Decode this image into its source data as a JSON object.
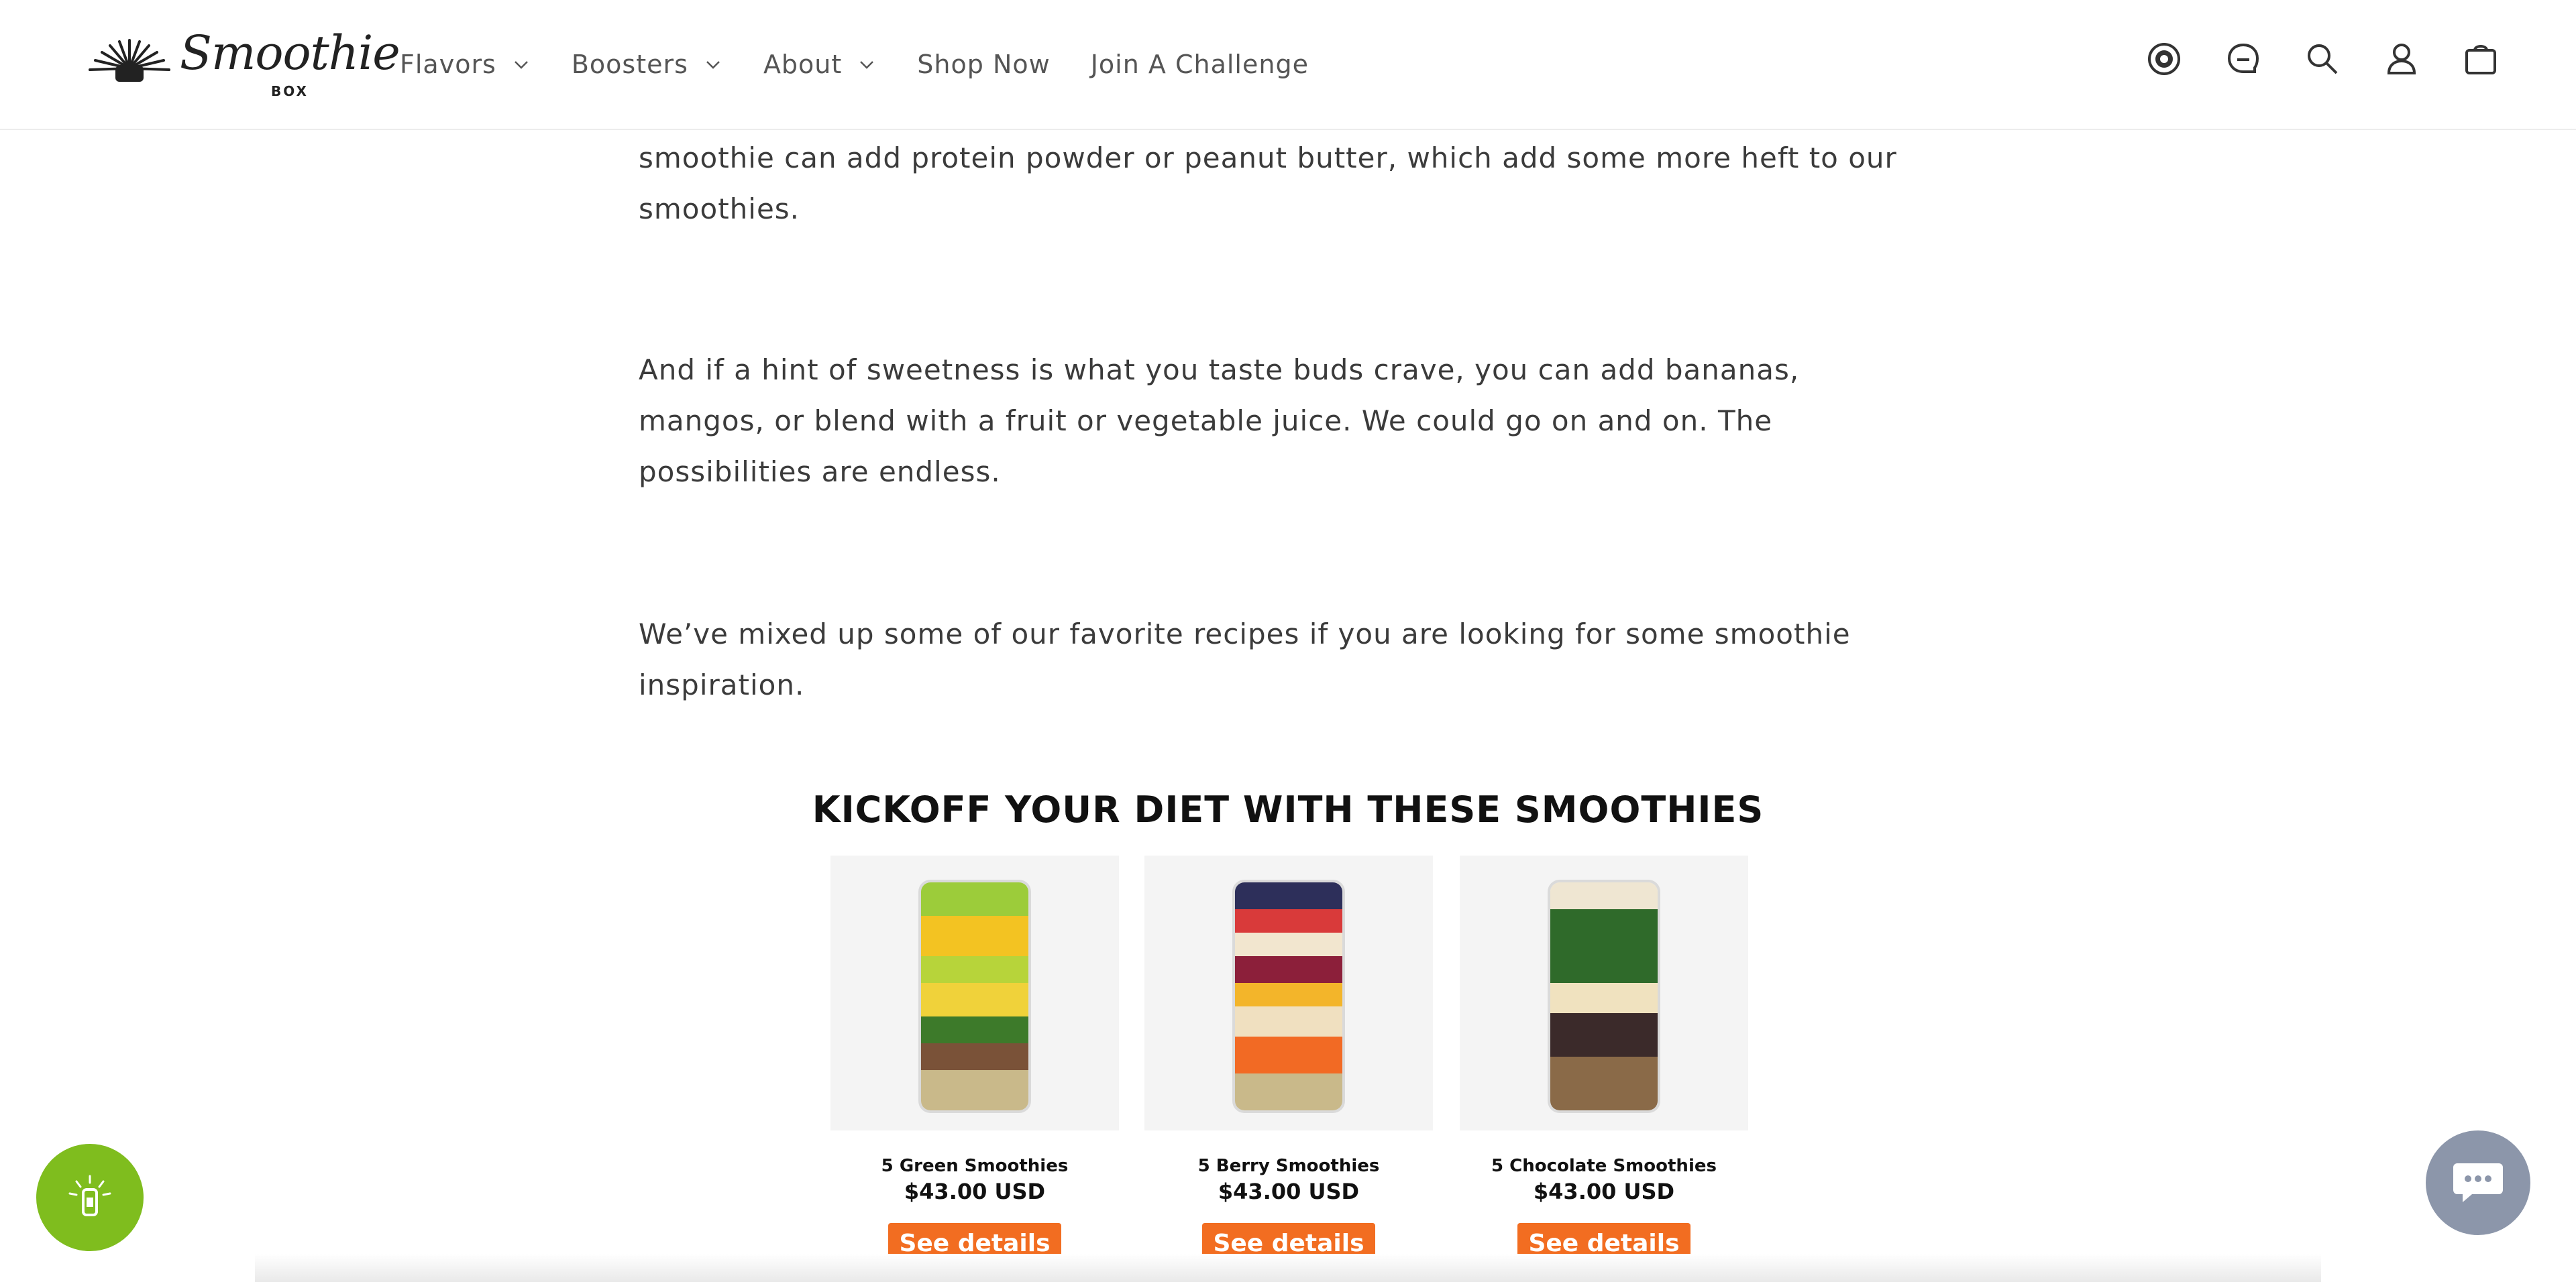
{
  "brand": {
    "name": "Smoothie",
    "sub": "BOX"
  },
  "nav": [
    {
      "label": "Flavors",
      "dropdown": true
    },
    {
      "label": "Boosters",
      "dropdown": true
    },
    {
      "label": "About",
      "dropdown": true
    },
    {
      "label": "Shop Now",
      "dropdown": false
    },
    {
      "label": "Join A Challenge",
      "dropdown": false
    }
  ],
  "header_icons": [
    "rewards-badge-icon",
    "chat-bubble-icon",
    "search-icon",
    "account-icon",
    "cart-icon"
  ],
  "article": {
    "p1": "smoothie can add protein powder or peanut butter, which add some more heft to our smoothies.",
    "p2": "And if a hint of sweetness is what you taste buds crave, you can add bananas, mangos, or blend with a fruit or vegetable juice. We could go on and on. The possibilities are endless.",
    "p3": "We’ve mixed up some of our favorite recipes if you are looking for some smoothie inspiration."
  },
  "section_title": "KICKOFF YOUR DIET WITH THESE SMOOTHIES",
  "products": [
    {
      "name": "5 Green Smoothies",
      "price": "$43.00 USD",
      "button": "See details"
    },
    {
      "name": "5 Berry Smoothies",
      "price": "$43.00 USD",
      "button": "See details"
    },
    {
      "name": "5 Chocolate Smoothies",
      "price": "$43.00 USD",
      "button": "See details"
    }
  ],
  "colors": {
    "accent": "#f26d21",
    "accessibility_green": "#7fbd1e",
    "chat_bubble": "#8c96aa"
  }
}
